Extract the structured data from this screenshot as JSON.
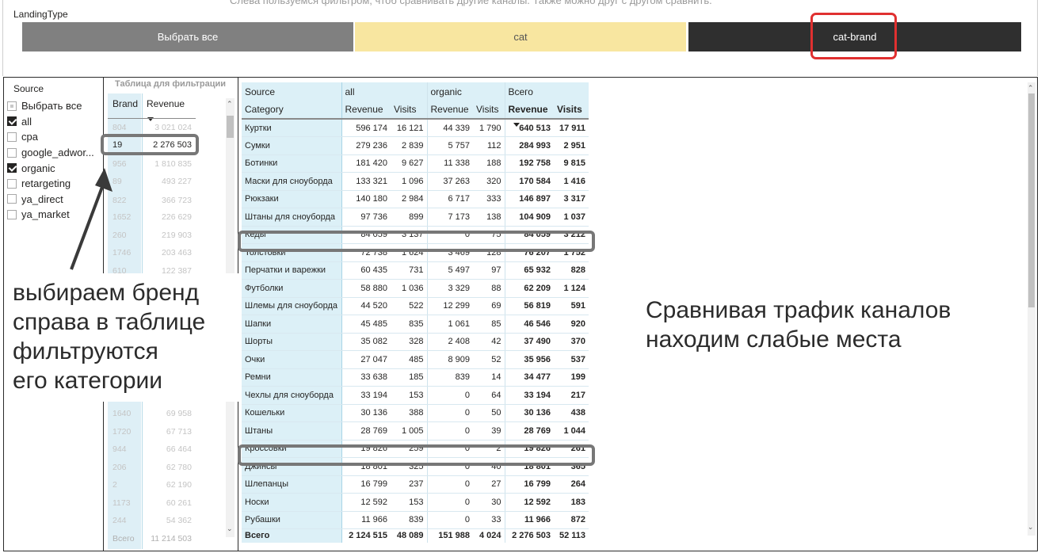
{
  "top_hint": "Слева пользуемся фильтром, чтоб сравнивать другие каналы. Также можно друг с другом сравнить.",
  "landing": {
    "label": "LandingType",
    "tiles": [
      "Выбрать все",
      "cat",
      "cat-brand"
    ],
    "selected": "cat-brand"
  },
  "source": {
    "title": "Source",
    "items": [
      {
        "label": "Выбрать все",
        "state": "partial"
      },
      {
        "label": "all",
        "state": "checked"
      },
      {
        "label": "cpa",
        "state": "unchecked"
      },
      {
        "label": "google_adwor...",
        "state": "unchecked"
      },
      {
        "label": "organic",
        "state": "checked"
      },
      {
        "label": "retargeting",
        "state": "unchecked"
      },
      {
        "label": "ya_direct",
        "state": "unchecked"
      },
      {
        "label": "ya_market",
        "state": "unchecked"
      }
    ]
  },
  "brand_table": {
    "title": "Таблица для фильтрации",
    "headers": [
      "Brand",
      "Revenue"
    ],
    "rows": [
      [
        "804",
        "3 021 024"
      ],
      [
        "19",
        "2 276 503"
      ],
      [
        "956",
        "1 810 835"
      ],
      [
        "89",
        "493 227"
      ],
      [
        "822",
        "366 723"
      ],
      [
        "1652",
        "226 629"
      ],
      [
        "260",
        "219 903"
      ],
      [
        "1746",
        "203 463"
      ],
      [
        "610",
        "122 387"
      ],
      [
        "1640",
        "69 958"
      ],
      [
        "1720",
        "67 713"
      ],
      [
        "944",
        "66 464"
      ],
      [
        "206",
        "62 780"
      ],
      [
        "2",
        "62 190"
      ],
      [
        "1173",
        "60 261"
      ],
      [
        "244",
        "54 362"
      ]
    ],
    "selected_brand": "19",
    "total": [
      "Всего",
      "11 214 503"
    ]
  },
  "annotations": {
    "left": [
      "выбираем бренд",
      "справа в таблице",
      "фильтруются",
      "его категории"
    ],
    "right": [
      "Сравнивая трафик каналов",
      "находим слабые места"
    ]
  },
  "matrix": {
    "source_label": "Source",
    "category_label": "Category",
    "groups": [
      "all",
      "organic",
      "Всего"
    ],
    "measures": [
      "Revenue",
      "Visits",
      "Revenue",
      "Visits",
      "Revenue",
      "Visits"
    ],
    "rows": [
      [
        "Куртки",
        "596 174",
        "16 121",
        "44 339",
        "1 790",
        "640 513",
        "17 911"
      ],
      [
        "Сумки",
        "279 236",
        "2 839",
        "5 757",
        "112",
        "284 993",
        "2 951"
      ],
      [
        "Ботинки",
        "181 420",
        "9 627",
        "11 338",
        "188",
        "192 758",
        "9 815"
      ],
      [
        "Маски для сноуборда",
        "133 321",
        "1 096",
        "37 263",
        "320",
        "170 584",
        "1 416"
      ],
      [
        "Рюкзаки",
        "140 180",
        "2 984",
        "6 717",
        "333",
        "146 897",
        "3 317"
      ],
      [
        "Штаны для сноуборда",
        "97 736",
        "899",
        "7 173",
        "138",
        "104 909",
        "1 037"
      ],
      [
        "Кеды",
        "84 059",
        "3 137",
        "0",
        "75",
        "84 059",
        "3 212"
      ],
      [
        "Толстовки",
        "72 738",
        "1 624",
        "3 469",
        "128",
        "76 207",
        "1 752"
      ],
      [
        "Перчатки и варежки",
        "60 435",
        "731",
        "5 497",
        "97",
        "65 932",
        "828"
      ],
      [
        "Футболки",
        "58 880",
        "1 036",
        "3 329",
        "88",
        "62 209",
        "1 124"
      ],
      [
        "Шлемы для сноуборда",
        "44 520",
        "522",
        "12 299",
        "69",
        "56 819",
        "591"
      ],
      [
        "Шапки",
        "45 485",
        "835",
        "1 061",
        "85",
        "46 546",
        "920"
      ],
      [
        "Шорты",
        "35 082",
        "328",
        "2 408",
        "42",
        "37 490",
        "370"
      ],
      [
        "Очки",
        "27 047",
        "485",
        "8 909",
        "52",
        "35 956",
        "537"
      ],
      [
        "Ремни",
        "33 638",
        "185",
        "839",
        "14",
        "34 477",
        "199"
      ],
      [
        "Чехлы для сноуборда",
        "33 194",
        "153",
        "0",
        "64",
        "33 194",
        "217"
      ],
      [
        "Кошельки",
        "30 136",
        "388",
        "0",
        "50",
        "30 136",
        "438"
      ],
      [
        "Штаны",
        "28 769",
        "1 005",
        "0",
        "39",
        "28 769",
        "1 044"
      ],
      [
        "Кроссовки",
        "19 826",
        "259",
        "0",
        "2",
        "19 826",
        "261"
      ],
      [
        "Джинсы",
        "18 801",
        "325",
        "0",
        "40",
        "18 801",
        "365"
      ],
      [
        "Шлепанцы",
        "16 799",
        "237",
        "0",
        "27",
        "16 799",
        "264"
      ],
      [
        "Носки",
        "12 592",
        "153",
        "0",
        "30",
        "12 592",
        "183"
      ],
      [
        "Рубашки",
        "11 966",
        "839",
        "0",
        "33",
        "11 966",
        "872"
      ]
    ],
    "total": [
      "Всего",
      "2 124 515",
      "48 089",
      "151 988",
      "4 024",
      "2 276 503",
      "52 113"
    ],
    "highlighted_rows": [
      "Кеды",
      "Кроссовки"
    ]
  }
}
